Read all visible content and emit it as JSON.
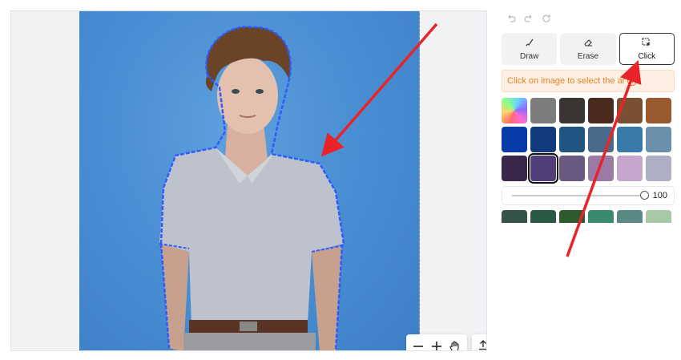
{
  "history": {
    "undo_icon": "undo-icon",
    "redo_icon": "redo-icon",
    "reset_icon": "reset-icon"
  },
  "modes": [
    {
      "label": "Draw",
      "icon": "brush-icon",
      "active": false
    },
    {
      "label": "Erase",
      "icon": "eraser-icon",
      "active": false
    },
    {
      "label": "Click",
      "icon": "click-select-icon",
      "active": true
    }
  ],
  "hint": {
    "text": "Click on image to select the ar",
    "info_icon": "info-icon"
  },
  "swatches_row1": [
    "gradient",
    "#7d7d7d",
    "#3a3533",
    "#4a2a1f",
    "#7a5035",
    "#9a5a30"
  ],
  "swatches_row2": [
    "#0a3aa8",
    "#123b7d",
    "#1f5580",
    "#4a6a8c",
    "#3a7aa8",
    "#6a90ab"
  ],
  "swatches_row3": [
    "#3a2648",
    "#523f7a",
    "#6b5a80",
    "#9c7aa6",
    "#c5a6cc",
    "#aeaec5"
  ],
  "swatches_row4": [
    "#35534a",
    "#2a5a45",
    "#2e5a30",
    "#3a8a72",
    "#5a8a85",
    "#a8c8a8"
  ],
  "selected_swatch": "#523f7a",
  "opacity": {
    "value": "100",
    "fraction": 1.0
  },
  "canvas_controls": {
    "zoom_out_icon": "minus-icon",
    "zoom_in_icon": "plus-icon",
    "pan_icon": "hand-icon",
    "upload_icon": "upload-icon"
  },
  "colors": {
    "accent_arrow": "#e8232a",
    "selection_outline": "#2e5bff",
    "hint_text": "#e2832d"
  }
}
